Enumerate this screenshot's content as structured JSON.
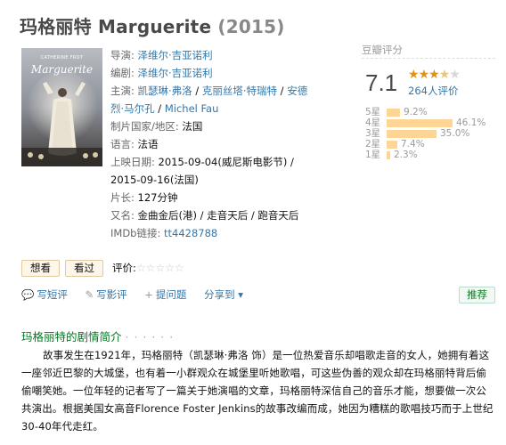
{
  "header": {
    "title_cn": "玛格丽特",
    "title_en": "Marguerite",
    "year": "(2015)"
  },
  "poster": {
    "credit": "CATHERINE FROT",
    "title": "Marguerite"
  },
  "info": {
    "director_label": "导演:",
    "director": "泽维尔·吉亚诺利",
    "writer_label": "编剧:",
    "writer": "泽维尔·吉亚诺利",
    "cast_label": "主演:",
    "cast": [
      "凯瑟琳·弗洛",
      "克丽丝塔·特瑞特",
      "安德烈·马尔孔",
      "Michel Fau"
    ],
    "cast_sep": " / ",
    "country_label": "制片国家/地区:",
    "country": "法国",
    "language_label": "语言:",
    "language": "法语",
    "release_label": "上映日期:",
    "release": "2015-09-04(威尼斯电影节) / 2015-09-16(法国)",
    "runtime_label": "片长:",
    "runtime": "127分钟",
    "aka_label": "又名:",
    "aka": "金曲金后(港) / 走音天后 / 跑音天后",
    "imdb_label": "IMDb链接:",
    "imdb": "tt4428788"
  },
  "rating": {
    "header": "豆瓣评分",
    "score": "7.1",
    "stars_value": 3.5,
    "votes": "264人评价",
    "distribution": [
      {
        "label": "5星",
        "pct": "9.2%",
        "value": 9.2
      },
      {
        "label": "4星",
        "pct": "46.1%",
        "value": 46.1
      },
      {
        "label": "3星",
        "pct": "35.0%",
        "value": 35.0
      },
      {
        "label": "2星",
        "pct": "7.4%",
        "value": 7.4
      },
      {
        "label": "1星",
        "pct": "2.3%",
        "value": 2.3
      }
    ]
  },
  "actions": {
    "want": "想看",
    "seen": "看过",
    "rate_label": "评价:",
    "rate_stars": "☆☆☆☆☆"
  },
  "tools": {
    "short_review": "写短评",
    "review": "写影评",
    "ask": "提问题",
    "share": "分享到",
    "recommend": "推荐"
  },
  "summary": {
    "title": "玛格丽特的剧情简介",
    "dots": "· · · · · ·",
    "text": "故事发生在1921年，玛格丽特（凯瑟琳·弗洛 饰）是一位热爱音乐却唱歌走音的女人，她拥有着这一座邻近巴黎的大城堡，也有着一小群观众在城堡里听她歌唱，可这些伪善的观众却在玛格丽特背后偷偷嘲笑她。一位年轻的记者写了一篇关于她演唱的文章，玛格丽特深信自己的音乐才能，想要做一次公共演出。根据美国女高音Florence Foster Jenkins的故事改编而成，她因为糟糕的歌唱技巧而于上世纪30-40年代走红。"
  }
}
